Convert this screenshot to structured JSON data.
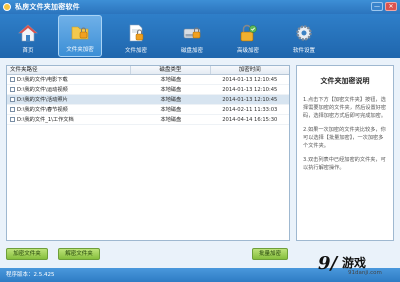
{
  "window": {
    "title": "私房文件夹加密软件",
    "minimize_label": "—",
    "close_label": "✕"
  },
  "toolbar": [
    {
      "label": "首页",
      "icon": "home-icon",
      "active": false
    },
    {
      "label": "文件夹加密",
      "icon": "folder-lock-icon",
      "active": true
    },
    {
      "label": "文件加密",
      "icon": "file-lock-icon",
      "active": false
    },
    {
      "label": "磁盘加密",
      "icon": "disk-lock-icon",
      "active": false
    },
    {
      "label": "高级加密",
      "icon": "advanced-lock-icon",
      "active": false
    },
    {
      "label": "软件设置",
      "icon": "settings-icon",
      "active": false
    }
  ],
  "table": {
    "headers": [
      "文件夹路径",
      "磁盘类型",
      "加密时间"
    ],
    "rows": [
      {
        "path": "D:\\我的文件\\电影下载",
        "disk": "本地磁盘",
        "time": "2014-01-13 12:10:45",
        "selected": false
      },
      {
        "path": "D:\\我的文件\\运动视频",
        "disk": "本地磁盘",
        "time": "2014-01-13 12:10:45",
        "selected": false
      },
      {
        "path": "D:\\我的文件\\活动照片",
        "disk": "本地磁盘",
        "time": "2014-01-13 12:10:45",
        "selected": true
      },
      {
        "path": "D:\\我的文件\\春节视频",
        "disk": "本地磁盘",
        "time": "2014-02-11 11:33:03",
        "selected": false
      },
      {
        "path": "D:\\我的文件_1\\工作文档",
        "disk": "本地磁盘",
        "time": "2014-04-14 16:15:30",
        "selected": false
      }
    ]
  },
  "help": {
    "title": "文件夹加密说明",
    "items": [
      "1.点击下方【加密文件夹】按钮，选择需要加密的文件夹，然后设置好密码，选择加密方式后即可完成加密。",
      "2.如果一次加密的文件夹比较多，你可以选择【批量加密】，一次加密多个文件夹。",
      "3.双击列表中已经加密的文件夹，可以执行解密操作。"
    ]
  },
  "buttons": {
    "encrypt_folder": "加密文件夹",
    "decrypt_folder": "解密文件夹",
    "batch_encrypt": "批量加密"
  },
  "status": {
    "version": "程序版本：2.5.425"
  },
  "watermark": {
    "mark": "9/",
    "text": "游戏",
    "url": "91danji.com"
  },
  "colors": {
    "titlebar": "#2b74bd",
    "toolbar": "#1f66ad",
    "button_green": "#86bf3c",
    "selected_row": "#d7e4f0"
  }
}
